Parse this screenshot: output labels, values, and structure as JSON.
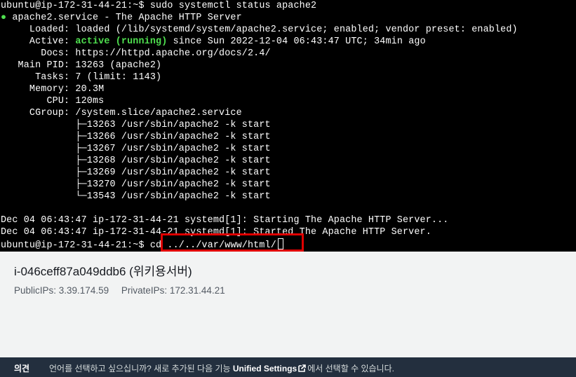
{
  "terminal": {
    "prompt": "ubuntu@ip-172-31-44-21:~$",
    "lines": [
      "ubuntu@ip-172-31-44-21:~$ sudo systemctl status apache2",
      "apache2.service - The Apache HTTP Server",
      "     Loaded: loaded (/lib/systemd/system/apache2.service; enabled; vendor preset: enabled)",
      "since Sun 2022-12-04 06:43:47 UTC; 34min ago",
      "       Docs: https://httpd.apache.org/docs/2.4/",
      "   Main PID: 13263 (apache2)",
      "      Tasks: 7 (limit: 1143)",
      "     Memory: 20.3M",
      "        CPU: 120ms",
      "     CGroup: /system.slice/apache2.service",
      "             ├─13263 /usr/sbin/apache2 -k start",
      "             ├─13266 /usr/sbin/apache2 -k start",
      "             ├─13267 /usr/sbin/apache2 -k start",
      "             ├─13268 /usr/sbin/apache2 -k start",
      "             ├─13269 /usr/sbin/apache2 -k start",
      "             ├─13270 /usr/sbin/apache2 -k start",
      "             └─13543 /usr/sbin/apache2 -k start",
      "Dec 04 06:43:47 ip-172-31-44-21 systemd[1]: Starting The Apache HTTP Server...",
      "Dec 04 06:43:47 ip-172-31-44-21 systemd[1]: Started The Apache HTTP Server.",
      "cd ../../var/www/html/"
    ],
    "status_bullet": "●",
    "active_label": "     Active: ",
    "active_status": "active (running)",
    "status_color": "#4fe04f"
  },
  "instance": {
    "title": "i-046ceff87a049ddb6 (위키용서버)",
    "public_ips": "PublicIPs: 3.39.174.59",
    "private_ips": "PrivateIPs: 172.31.44.21"
  },
  "footer": {
    "label": "의견",
    "text_before": "언어를 선택하고 싶으십니까? 새로 추가된 다음 기능 ",
    "link": "Unified Settings",
    "text_after": "에서 선택할 수 있습니다."
  },
  "icons": {
    "external_link": "external-link-icon",
    "cursor": "cursor-block"
  },
  "colors": {
    "terminal_bg": "#000000",
    "highlight": "#e00000",
    "panel_bg": "#f2f3f3",
    "footer_bg": "#232f3e"
  }
}
